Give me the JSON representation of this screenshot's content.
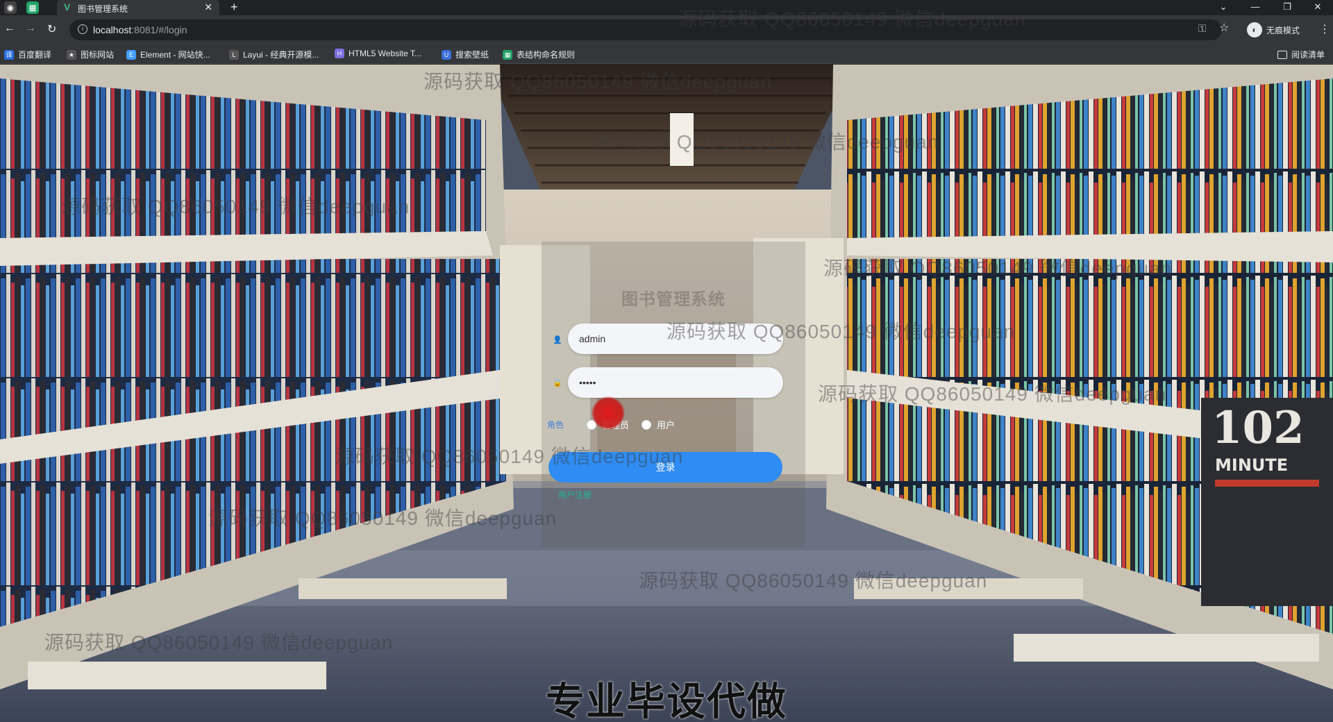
{
  "browser": {
    "tab_title": "图书管理系统",
    "new_tab_icon": "plus-icon",
    "url_host": "localhost",
    "url_rest": ":8081/#/login",
    "profile_label": "无痕模式",
    "reading_list": "阅读清单",
    "bookmarks": [
      {
        "label": "百度翻译",
        "color": "#2b6fe0"
      },
      {
        "label": "图标网站",
        "color": "#555555"
      },
      {
        "label": "Element - 网站快...",
        "color": "#409eff"
      },
      {
        "label": "Layui - 经典开源模...",
        "color": "#555555"
      },
      {
        "label": "HTML5 Website T...",
        "color": "#7c6fe0"
      },
      {
        "label": "搜索壁纸",
        "color": "#3a6fd8"
      },
      {
        "label": "表结构命名规则",
        "color": "#21a366"
      }
    ]
  },
  "login": {
    "title": "图书管理系统",
    "username_value": "admin",
    "password_value": "•••••",
    "role_label": "角色",
    "role_options": [
      "管理员",
      "用户"
    ],
    "login_button": "登录",
    "register_link": "用户注册"
  },
  "watermark": "源码获取 QQ86050149 微信deepguan",
  "caption": "专业毕设代做",
  "colors": {
    "accent": "#2f8cf2",
    "register": "#23b59a",
    "chrome_dark": "#202124",
    "chrome": "#35363a"
  }
}
